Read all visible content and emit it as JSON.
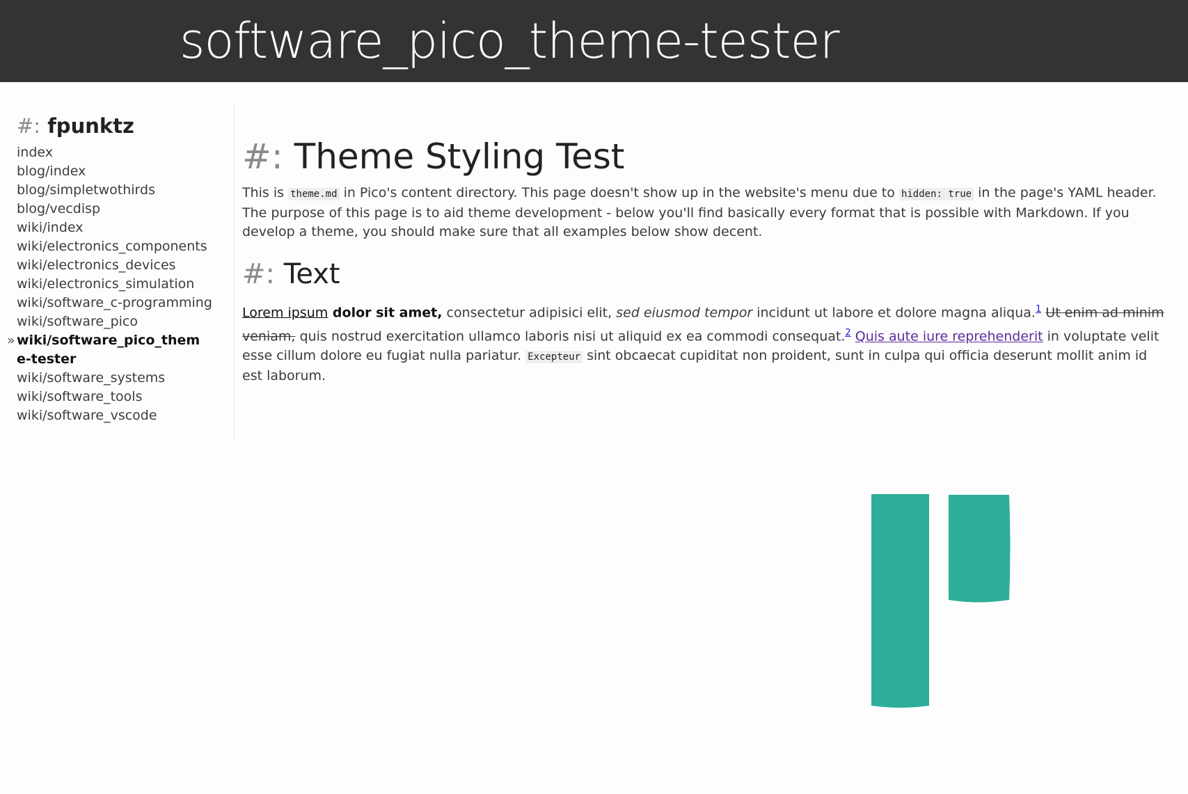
{
  "header": {
    "site_title": "software_pico_theme-tester"
  },
  "sidebar": {
    "hash": "#:",
    "heading": "fpunktz",
    "items": [
      {
        "label": "index"
      },
      {
        "label": "blog/index"
      },
      {
        "label": "blog/simpletwothirds"
      },
      {
        "label": "blog/vecdisp"
      },
      {
        "label": "wiki/index"
      },
      {
        "label": "wiki/electronics_components"
      },
      {
        "label": "wiki/electronics_devices"
      },
      {
        "label": "wiki/electronics_simulation"
      },
      {
        "label": "wiki/software_c-programming"
      },
      {
        "label": "wiki/software_pico"
      },
      {
        "label": "wiki/software_pico_theme-tester",
        "active": true,
        "marker": "»"
      },
      {
        "label": "wiki/software_systems"
      },
      {
        "label": "wiki/software_tools"
      },
      {
        "label": "wiki/software_vscode"
      }
    ]
  },
  "content": {
    "h1_hash": "#:",
    "h1": "Theme Styling Test",
    "intro": {
      "t1": "This is ",
      "code1": "theme.md",
      "t2": " in Pico's content directory. This page doesn't show up in the website's menu due to ",
      "code2": "hidden: true",
      "t3": " in the page's YAML header. The purpose of this page is to aid theme development - below you'll find basically every format that is possible with Markdown. If you develop a theme, you should make sure that all examples below show decent."
    },
    "h2_hash": "#:",
    "h2": "Text",
    "text_para": {
      "underlined": "Lorem ipsum",
      "bold": " dolor sit amet,",
      "t1": " consectetur adipisici elit, ",
      "italic": "sed eiusmod tempor",
      "t2": " incidunt ut labore et dolore magna aliqua.",
      "fn1": "1",
      "strike": "Ut enim ad minim veniam,",
      "t3": " quis nostrud exercitation ullamco laboris nisi ut aliquid ex ea commodi consequat.",
      "fn2": "2",
      "link": "Quis aute iure reprehenderit",
      "t4": " in voluptate velit esse cillum dolore eu fugiat nulla pariatur. ",
      "code": "Excepteur",
      "t5": " sint obcaecat cupiditat non proident, sunt in culpa qui officia deserunt mollit anim id est laborum."
    }
  },
  "logo": {
    "name": "pico-logo",
    "color": "#2eae99"
  },
  "colors": {
    "header_bg": "#333333",
    "page_bg": "#fdfdfd",
    "link_visited": "#5b2a9a"
  }
}
